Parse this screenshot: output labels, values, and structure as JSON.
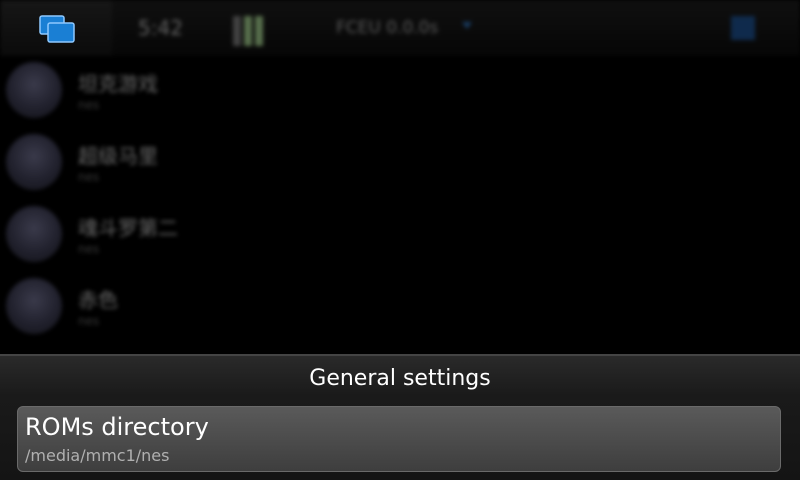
{
  "status_bar": {
    "time": "5:42",
    "app_title": "FCEU 0.0.0s"
  },
  "background_list": {
    "items": [
      {
        "name": "坦克游戏",
        "sub": "nes"
      },
      {
        "name": "超级马里",
        "sub": "nes"
      },
      {
        "name": "魂斗罗第二",
        "sub": "nes"
      },
      {
        "name": "赤色",
        "sub": "nes"
      }
    ]
  },
  "dialog": {
    "title": "General settings",
    "item": {
      "label": "ROMs directory",
      "value": "/media/mmc1/nes"
    }
  },
  "colors": {
    "accent_blue": "#1a7fd4",
    "dialog_bg": "#1a1a1a",
    "item_bg": "#4a4a4a"
  }
}
